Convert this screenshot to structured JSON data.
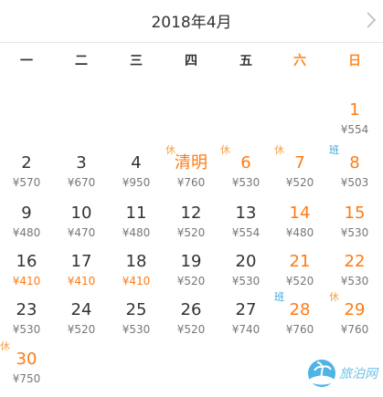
{
  "header": {
    "title": "2018年4月"
  },
  "weekdays": [
    {
      "label": "一",
      "weekend": false
    },
    {
      "label": "二",
      "weekend": false
    },
    {
      "label": "三",
      "weekend": false
    },
    {
      "label": "四",
      "weekend": false
    },
    {
      "label": "五",
      "weekend": false
    },
    {
      "label": "六",
      "weekend": true
    },
    {
      "label": "日",
      "weekend": true
    }
  ],
  "days": [
    {
      "day": "1",
      "price": "¥554",
      "col": 6,
      "row": 0,
      "day_orange": true,
      "price_orange": false,
      "tag": ""
    },
    {
      "day": "2",
      "price": "¥570",
      "col": 0,
      "row": 1,
      "day_orange": false,
      "price_orange": false,
      "tag": ""
    },
    {
      "day": "3",
      "price": "¥670",
      "col": 1,
      "row": 1,
      "day_orange": false,
      "price_orange": false,
      "tag": ""
    },
    {
      "day": "4",
      "price": "¥950",
      "col": 2,
      "row": 1,
      "day_orange": false,
      "price_orange": false,
      "tag": ""
    },
    {
      "day": "清明",
      "price": "¥760",
      "col": 3,
      "row": 1,
      "day_orange": true,
      "price_orange": false,
      "tag": "休"
    },
    {
      "day": "6",
      "price": "¥530",
      "col": 4,
      "row": 1,
      "day_orange": true,
      "price_orange": false,
      "tag": "休"
    },
    {
      "day": "7",
      "price": "¥520",
      "col": 5,
      "row": 1,
      "day_orange": true,
      "price_orange": false,
      "tag": "休"
    },
    {
      "day": "8",
      "price": "¥503",
      "col": 6,
      "row": 1,
      "day_orange": true,
      "price_orange": false,
      "tag": "班"
    },
    {
      "day": "9",
      "price": "¥480",
      "col": 0,
      "row": 2,
      "day_orange": false,
      "price_orange": false,
      "tag": ""
    },
    {
      "day": "10",
      "price": "¥470",
      "col": 1,
      "row": 2,
      "day_orange": false,
      "price_orange": false,
      "tag": ""
    },
    {
      "day": "11",
      "price": "¥480",
      "col": 2,
      "row": 2,
      "day_orange": false,
      "price_orange": false,
      "tag": ""
    },
    {
      "day": "12",
      "price": "¥520",
      "col": 3,
      "row": 2,
      "day_orange": false,
      "price_orange": false,
      "tag": ""
    },
    {
      "day": "13",
      "price": "¥554",
      "col": 4,
      "row": 2,
      "day_orange": false,
      "price_orange": false,
      "tag": ""
    },
    {
      "day": "14",
      "price": "¥480",
      "col": 5,
      "row": 2,
      "day_orange": true,
      "price_orange": false,
      "tag": ""
    },
    {
      "day": "15",
      "price": "¥530",
      "col": 6,
      "row": 2,
      "day_orange": true,
      "price_orange": false,
      "tag": ""
    },
    {
      "day": "16",
      "price": "¥410",
      "col": 0,
      "row": 3,
      "day_orange": false,
      "price_orange": true,
      "tag": ""
    },
    {
      "day": "17",
      "price": "¥410",
      "col": 1,
      "row": 3,
      "day_orange": false,
      "price_orange": true,
      "tag": ""
    },
    {
      "day": "18",
      "price": "¥410",
      "col": 2,
      "row": 3,
      "day_orange": false,
      "price_orange": true,
      "tag": ""
    },
    {
      "day": "19",
      "price": "¥520",
      "col": 3,
      "row": 3,
      "day_orange": false,
      "price_orange": false,
      "tag": ""
    },
    {
      "day": "20",
      "price": "¥530",
      "col": 4,
      "row": 3,
      "day_orange": false,
      "price_orange": false,
      "tag": ""
    },
    {
      "day": "21",
      "price": "¥520",
      "col": 5,
      "row": 3,
      "day_orange": true,
      "price_orange": false,
      "tag": ""
    },
    {
      "day": "22",
      "price": "¥530",
      "col": 6,
      "row": 3,
      "day_orange": true,
      "price_orange": false,
      "tag": ""
    },
    {
      "day": "23",
      "price": "¥530",
      "col": 0,
      "row": 4,
      "day_orange": false,
      "price_orange": false,
      "tag": ""
    },
    {
      "day": "24",
      "price": "¥520",
      "col": 1,
      "row": 4,
      "day_orange": false,
      "price_orange": false,
      "tag": ""
    },
    {
      "day": "25",
      "price": "¥530",
      "col": 2,
      "row": 4,
      "day_orange": false,
      "price_orange": false,
      "tag": ""
    },
    {
      "day": "26",
      "price": "¥520",
      "col": 3,
      "row": 4,
      "day_orange": false,
      "price_orange": false,
      "tag": ""
    },
    {
      "day": "27",
      "price": "¥740",
      "col": 4,
      "row": 4,
      "day_orange": false,
      "price_orange": false,
      "tag": ""
    },
    {
      "day": "28",
      "price": "¥760",
      "col": 5,
      "row": 4,
      "day_orange": true,
      "price_orange": false,
      "tag": "班"
    },
    {
      "day": "29",
      "price": "¥760",
      "col": 6,
      "row": 4,
      "day_orange": true,
      "price_orange": false,
      "tag": "休"
    },
    {
      "day": "30",
      "price": "¥750",
      "col": 0,
      "row": 5,
      "day_orange": true,
      "price_orange": false,
      "tag": "休"
    }
  ],
  "watermark": {
    "text": "旅泊网"
  },
  "colors": {
    "accent": "#ff7a14",
    "rest_tag": "#f3a44a",
    "work_tag": "#33a3dc",
    "text": "#333333",
    "price": "#777777"
  },
  "icons": {
    "next": "chevron-right-icon",
    "logo": "beach-logo-icon"
  }
}
